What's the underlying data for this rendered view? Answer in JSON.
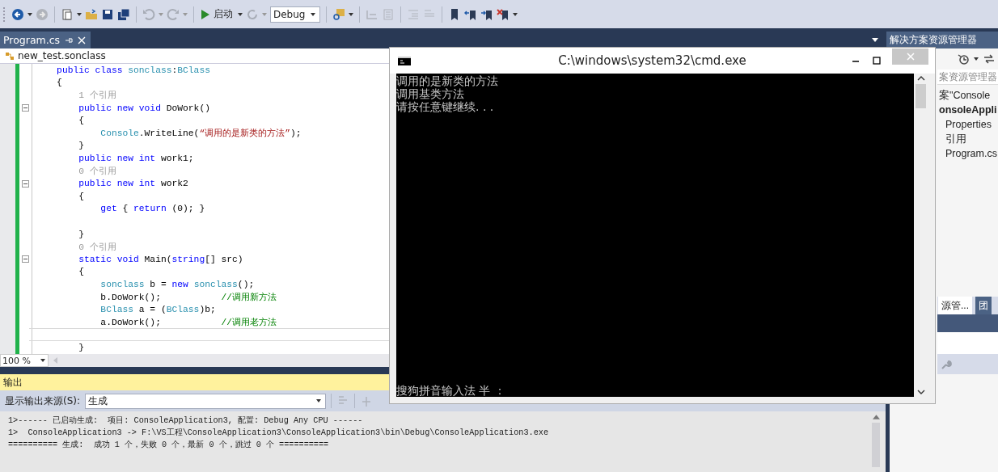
{
  "toolbar": {
    "run_label": "启动",
    "configuration": "Debug"
  },
  "document_tab": {
    "label": "Program.cs",
    "selected": true
  },
  "navigation_bar": {
    "scope": "new_test.sonclass"
  },
  "code": {
    "lines": [
      {
        "tokens": [
          {
            "kind": "kw",
            "text": "    public class "
          },
          {
            "kind": "type",
            "text": "sonclass"
          },
          {
            "kind": "plain",
            "text": ":"
          },
          {
            "kind": "type",
            "text": "BClass"
          }
        ]
      },
      {
        "tokens": [
          {
            "kind": "plain",
            "text": "    {"
          }
        ]
      },
      {
        "tokens": [
          {
            "kind": "codelens",
            "text": "        1 个引用"
          }
        ]
      },
      {
        "fold": true,
        "tokens": [
          {
            "kind": "kw",
            "text": "        public new void "
          },
          {
            "kind": "plain",
            "text": "DoWork()"
          }
        ]
      },
      {
        "tokens": [
          {
            "kind": "plain",
            "text": "        {"
          }
        ]
      },
      {
        "tokens": [
          {
            "kind": "type",
            "text": "            Console"
          },
          {
            "kind": "plain",
            "text": ".WriteLine("
          },
          {
            "kind": "str",
            "text": "“调用的是新类的方法”"
          },
          {
            "kind": "plain",
            "text": ");"
          }
        ]
      },
      {
        "tokens": [
          {
            "kind": "plain",
            "text": "        }"
          }
        ]
      },
      {
        "tokens": [
          {
            "kind": "kw",
            "text": "        public new int "
          },
          {
            "kind": "plain",
            "text": "work1;"
          }
        ]
      },
      {
        "tokens": [
          {
            "kind": "codelens",
            "text": "        0 个引用"
          }
        ]
      },
      {
        "fold": true,
        "tokens": [
          {
            "kind": "kw",
            "text": "        public new int "
          },
          {
            "kind": "plain",
            "text": "work2"
          }
        ]
      },
      {
        "tokens": [
          {
            "kind": "plain",
            "text": "        {"
          }
        ]
      },
      {
        "tokens": [
          {
            "kind": "kw",
            "text": "            get"
          },
          {
            "kind": "plain",
            "text": " { "
          },
          {
            "kind": "kw",
            "text": "return"
          },
          {
            "kind": "plain",
            "text": " (0); }"
          }
        ]
      },
      {
        "fold": false
      },
      {
        "tokens": [
          {
            "kind": "plain",
            "text": "        }"
          }
        ]
      },
      {
        "tokens": [
          {
            "kind": "codelens",
            "text": "        0 个引用"
          }
        ]
      },
      {
        "fold": true,
        "tokens": [
          {
            "kind": "kw",
            "text": "        static void "
          },
          {
            "kind": "plain",
            "text": "Main("
          },
          {
            "kind": "kw",
            "text": "string"
          },
          {
            "kind": "plain",
            "text": "[] src)"
          }
        ]
      },
      {
        "tokens": [
          {
            "kind": "plain",
            "text": "        {"
          }
        ]
      },
      {
        "tokens": [
          {
            "kind": "type",
            "text": "            sonclass"
          },
          {
            "kind": "plain",
            "text": " b = "
          },
          {
            "kind": "kw",
            "text": "new "
          },
          {
            "kind": "type",
            "text": "sonclass"
          },
          {
            "kind": "plain",
            "text": "();"
          }
        ]
      },
      {
        "tokens": [
          {
            "kind": "plain",
            "text": "            b.DoWork();           "
          },
          {
            "kind": "cmt",
            "text": "//调用新方法"
          }
        ]
      },
      {
        "tokens": [
          {
            "kind": "type",
            "text": "            BClass"
          },
          {
            "kind": "plain",
            "text": " a = ("
          },
          {
            "kind": "type",
            "text": "BClass"
          },
          {
            "kind": "plain",
            "text": ")b;"
          }
        ]
      },
      {
        "tokens": [
          {
            "kind": "plain",
            "text": "            a.DoWork();           "
          },
          {
            "kind": "cmt",
            "text": "//调用老方法"
          }
        ]
      },
      {
        "current": true
      },
      {
        "tokens": [
          {
            "kind": "plain",
            "text": "        }"
          }
        ]
      }
    ]
  },
  "zoom": {
    "value": "100 %"
  },
  "output": {
    "title": "输出",
    "source_label": "显示输出来源(S):",
    "source": "生成",
    "lines": [
      "1>------ 已启动生成:  项目: ConsoleApplication3, 配置: Debug Any CPU ------",
      "1>  ConsoleApplication3 -> F:\\VS工程\\ConsoleApplication3\\ConsoleApplication3\\bin\\Debug\\ConsoleApplication3.exe",
      "========== 生成:  成功 1 个，失败 0 个，最新 0 个，跳过 0 个 =========="
    ]
  },
  "solution_explorer": {
    "title": "解决方案资源管理器",
    "search_placeholder": "案资源管理器",
    "items": [
      {
        "label": "案\"Console",
        "kind": "solution"
      },
      {
        "label": "onsoleAppli",
        "kind": "project"
      },
      {
        "label": "Properties",
        "kind": "folder"
      },
      {
        "label": "引用",
        "kind": "folder"
      },
      {
        "label": "Program.cs",
        "kind": "file"
      }
    ],
    "tabs": [
      {
        "label": "源管...",
        "selected": true
      },
      {
        "label": "团",
        "selected": false
      }
    ]
  },
  "console_window": {
    "title": "C:\\windows\\system32\\cmd.exe",
    "lines": [
      "调用的是新类的方法",
      "调用基类方法",
      "请按任意键继续. . ."
    ],
    "ime_status": "搜狗拼音输入法 半 ："
  }
}
